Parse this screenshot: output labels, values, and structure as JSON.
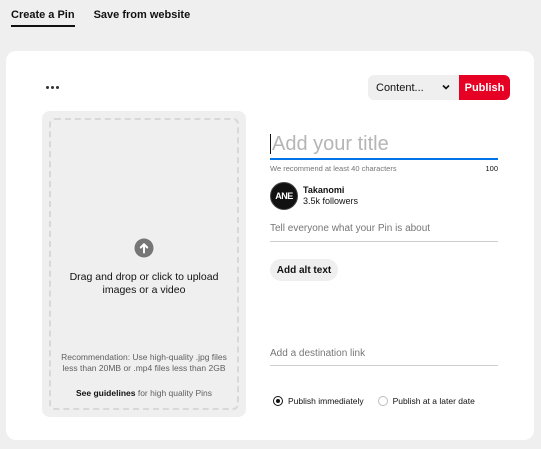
{
  "tabs": [
    {
      "label": "Create a Pin",
      "active": true
    },
    {
      "label": "Save from website",
      "active": false
    }
  ],
  "toolbar": {
    "more_icon": "more-horizontal-icon",
    "board_select_value": "Content...",
    "board_select_icon": "chevron-down-icon",
    "publish_label": "Publish",
    "publish_color": "#e60023"
  },
  "upload": {
    "icon": "arrow-up-circle-icon",
    "drop_text": "Drag and drop or click to upload images or a video",
    "recommendation": "Recommendation: Use high-quality .jpg files less than 20MB or .mp4 files less than 2GB",
    "guidelines_link": "See guidelines",
    "guidelines_suffix": " for high quality Pins"
  },
  "form": {
    "title_placeholder": "Add your title",
    "title_helper": "We recommend at least 40 characters",
    "title_counter": "100",
    "title_focus_color": "#0074e8",
    "author_avatar_text": "ANE",
    "author_name": "Takanomi",
    "author_followers": "3.5k followers",
    "description_placeholder": "Tell everyone what your Pin is about",
    "alt_text_button": "Add alt text",
    "link_placeholder": "Add a destination link"
  },
  "publish_options": [
    {
      "label": "Publish immediately",
      "selected": true
    },
    {
      "label": "Publish at a later date",
      "selected": false
    }
  ]
}
